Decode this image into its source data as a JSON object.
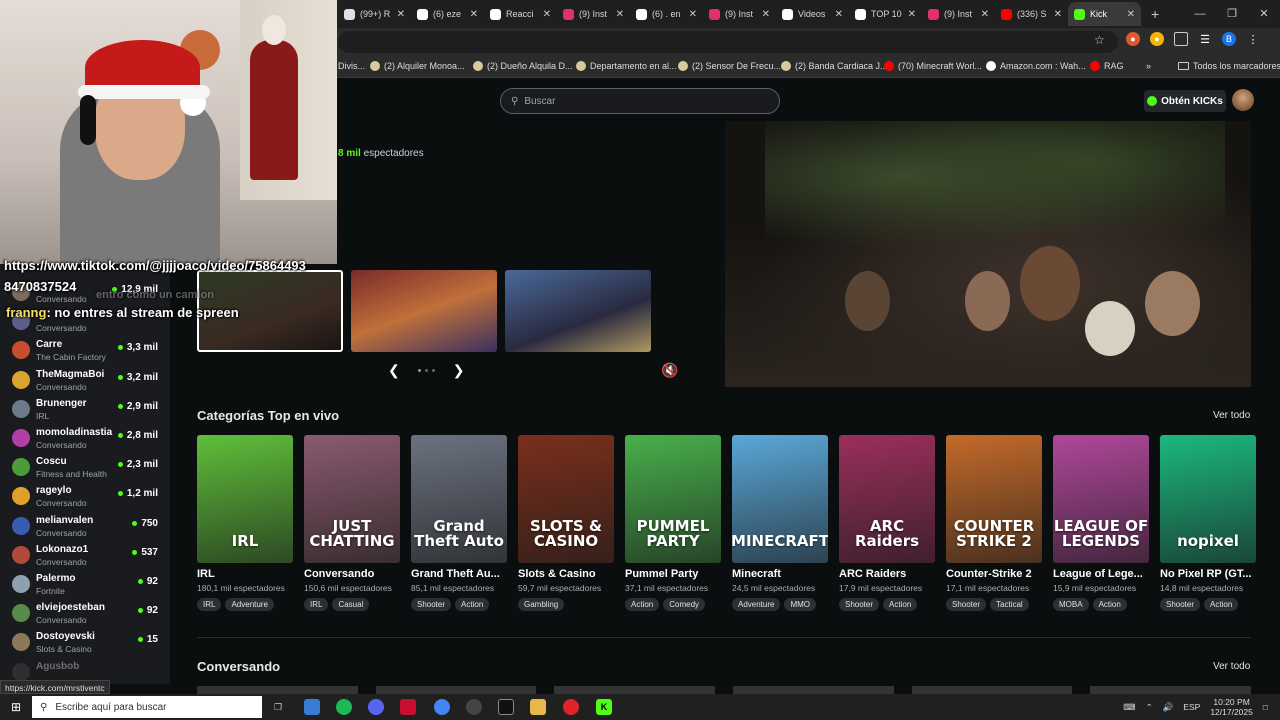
{
  "browser": {
    "tabs": [
      {
        "label": "(99+) R",
        "icon": "gmail-icon",
        "color": "#e0e0e0"
      },
      {
        "label": "(6) eze",
        "icon": "x-icon",
        "color": "#ffffff"
      },
      {
        "label": "Reacci",
        "icon": "tiktok-icon",
        "color": "#ffffff"
      },
      {
        "label": "(9) Inst",
        "icon": "instagram-icon",
        "color": "#e1306c"
      },
      {
        "label": "(6) . en",
        "icon": "x-icon",
        "color": "#ffffff"
      },
      {
        "label": "(9) Inst",
        "icon": "instagram-icon",
        "color": "#e1306c"
      },
      {
        "label": "Videos",
        "icon": "tiktok-icon",
        "color": "#ffffff"
      },
      {
        "label": "TOP 10",
        "icon": "tiktok-icon",
        "color": "#ffffff"
      },
      {
        "label": "(9) Inst",
        "icon": "instagram-icon",
        "color": "#e1306c"
      },
      {
        "label": "(336) S",
        "icon": "youtube-icon",
        "color": "#ff0000"
      },
      {
        "label": "Kick",
        "icon": "kick-icon",
        "color": "#53fc18",
        "active": true
      }
    ],
    "new_tab": "+",
    "bookmarks": [
      {
        "label": "Divis...",
        "icon": "bookmark-icon"
      },
      {
        "label": "(2) Alquiler Monoa...",
        "icon": "bookmark-icon"
      },
      {
        "label": "(2) Dueño Alquila D...",
        "icon": "bookmark-icon"
      },
      {
        "label": "Departamento en al...",
        "icon": "bookmark-icon"
      },
      {
        "label": "(2) Sensor De Frecu...",
        "icon": "bookmark-icon"
      },
      {
        "label": "(2) Banda Cardiaca J...",
        "icon": "bookmark-icon"
      },
      {
        "label": "(70) Minecraft Worl...",
        "icon": "youtube-icon"
      },
      {
        "label": "Amazon.com : Wah...",
        "icon": "amazon-icon"
      },
      {
        "label": "RAG",
        "icon": "youtube-icon"
      }
    ],
    "bookmarks_more": "»",
    "all_bookmarks": "Todos los marcadores",
    "status_url": "https://kick.com/mrstiventc"
  },
  "kick": {
    "search_placeholder": "Buscar",
    "kicks_button": "Obtén KICKs",
    "featured_viewers_num": "8 mil",
    "featured_viewers_label": "espectadores",
    "categories_title": "Categorías Top en vivo",
    "categories_more": "Ver todo",
    "conversando_title": "Conversando",
    "conversando_more": "Ver todo",
    "categories": [
      {
        "name": "IRL",
        "art": "IRL",
        "viewers": "180,1 mil espectadores",
        "tags": [
          "IRL",
          "Adventure"
        ],
        "bg": "#5fbf3a"
      },
      {
        "name": "Conversando",
        "art": "JUST CHATTING",
        "viewers": "150,6 mil espectadores",
        "tags": [
          "IRL",
          "Casual"
        ],
        "bg": "#8a5a6e"
      },
      {
        "name": "Grand Theft Au...",
        "art": "Grand Theft Auto",
        "viewers": "85,1 mil espectadores",
        "tags": [
          "Shooter",
          "Action"
        ],
        "bg": "#6b7280"
      },
      {
        "name": "Slots & Casino",
        "art": "SLOTS & CASINO",
        "viewers": "59,7 mil espectadores",
        "tags": [
          "Gambling"
        ],
        "bg": "#7a2f1c"
      },
      {
        "name": "Pummel Party",
        "art": "PUMMEL PARTY",
        "viewers": "37,1 mil espectadores",
        "tags": [
          "Action",
          "Comedy"
        ],
        "bg": "#48b04b"
      },
      {
        "name": "Minecraft",
        "art": "MINECRAFT",
        "viewers": "24,5 mil espectadores",
        "tags": [
          "Adventure",
          "MMO"
        ],
        "bg": "#5aa8d8"
      },
      {
        "name": "ARC Raiders",
        "art": "ARC Raiders",
        "viewers": "17,9 mil espectadores",
        "tags": [
          "Shooter",
          "Action"
        ],
        "bg": "#9b2f5c"
      },
      {
        "name": "Counter-Strike 2",
        "art": "COUNTER STRIKE 2",
        "viewers": "17,1 mil espectadores",
        "tags": [
          "Shooter",
          "Tactical"
        ],
        "bg": "#c46a2a"
      },
      {
        "name": "League of Lege...",
        "art": "LEAGUE OF LEGENDS",
        "viewers": "15,9 mil espectadores",
        "tags": [
          "MOBA",
          "Action"
        ],
        "bg": "#b0479a"
      },
      {
        "name": "No Pixel RP (GT...",
        "art": "nopixel",
        "viewers": "14,8 mil espectadores",
        "tags": [
          "Shooter",
          "Action"
        ],
        "bg": "#1bb87f"
      }
    ],
    "sidebar": [
      {
        "name": "",
        "category": "Conversando",
        "viewers": "12,9 mil",
        "avatar": "#7d6a5a"
      },
      {
        "name": "",
        "category": "Conversando",
        "viewers": "",
        "avatar": "#5b5f8a"
      },
      {
        "name": "Carre",
        "category": "The Cabin Factory",
        "viewers": "3,3 mil",
        "avatar": "#c84d2d"
      },
      {
        "name": "TheMagmaBoi",
        "category": "Conversando",
        "viewers": "3,2 mil",
        "avatar": "#d9a52c"
      },
      {
        "name": "Brunenger",
        "category": "IRL",
        "viewers": "2,9 mil",
        "avatar": "#6c7a8a"
      },
      {
        "name": "momoladinastia",
        "category": "Conversando",
        "viewers": "2,8 mil",
        "avatar": "#b23fa8"
      },
      {
        "name": "Coscu",
        "category": "Fitness and Health",
        "viewers": "2,3 mil",
        "avatar": "#4a9d3a"
      },
      {
        "name": "rageylo",
        "category": "Conversando",
        "viewers": "1,2 mil",
        "avatar": "#e0a12a"
      },
      {
        "name": "melianvalen",
        "category": "Conversando",
        "viewers": "750",
        "avatar": "#3a5cb0"
      },
      {
        "name": "Lokonazo1",
        "category": "Conversando",
        "viewers": "537",
        "avatar": "#b04a3a"
      },
      {
        "name": "Palermo",
        "category": "Fortnite",
        "viewers": "92",
        "avatar": "#8fa0b0"
      },
      {
        "name": "elviejoesteban",
        "category": "Conversando",
        "viewers": "92",
        "avatar": "#5a8a4a"
      },
      {
        "name": "Dostoyevski",
        "category": "Slots & Casino",
        "viewers": "15",
        "avatar": "#8a7a5a"
      },
      {
        "name": "Agusbob",
        "category": "",
        "viewers": "",
        "avatar": "#555"
      }
    ]
  },
  "overlay": {
    "line1": "https://www.tiktok.com/@jjjjoaco/video/75864493",
    "line2": "8470837524",
    "line3_user": "franng",
    "line3_text": ": no entres al stream de spreen",
    "ghost": "entro como un camion"
  },
  "taskbar": {
    "search_placeholder": "Escribe aquí para buscar",
    "lang": "ESP",
    "time": "10:20 PM",
    "date": "12/17/2025"
  }
}
